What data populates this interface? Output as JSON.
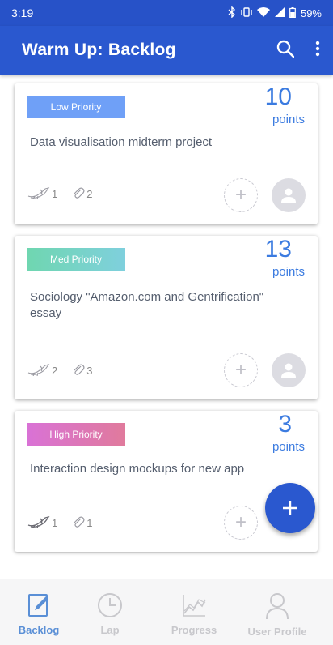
{
  "status_bar": {
    "time": "3:19",
    "battery": "59%"
  },
  "app_bar": {
    "title": "Warm Up: Backlog"
  },
  "cards": [
    {
      "priority": "Low Priority",
      "points": "10",
      "points_label": "points",
      "task": "Data visualisation midterm project",
      "comments": "1",
      "attachments": "2"
    },
    {
      "priority": "Med Priority",
      "points": "13",
      "points_label": "points",
      "task": "Sociology \"Amazon.com and Gentrification\" essay",
      "comments": "2",
      "attachments": "3"
    },
    {
      "priority": "High Priority",
      "points": "3",
      "points_label": "points",
      "task": "Interaction design mockups for new app",
      "comments": "1",
      "attachments": "1"
    }
  ],
  "fab": {
    "icon": "plus-icon"
  },
  "bottom_nav": {
    "items": [
      {
        "label": "Backlog",
        "icon": "edit-note-icon",
        "active": true
      },
      {
        "label": "Lap",
        "icon": "clock-icon",
        "active": false
      },
      {
        "label": "Progress",
        "icon": "line-chart-icon",
        "active": false
      },
      {
        "label": "User Profile",
        "icon": "user-icon",
        "active": false
      }
    ]
  },
  "colors": {
    "primary": "#2a58cf",
    "accent_text": "#3b7be0",
    "low": "#6fa0f7",
    "med": "#72d4c4",
    "high": "#dc76b8"
  }
}
